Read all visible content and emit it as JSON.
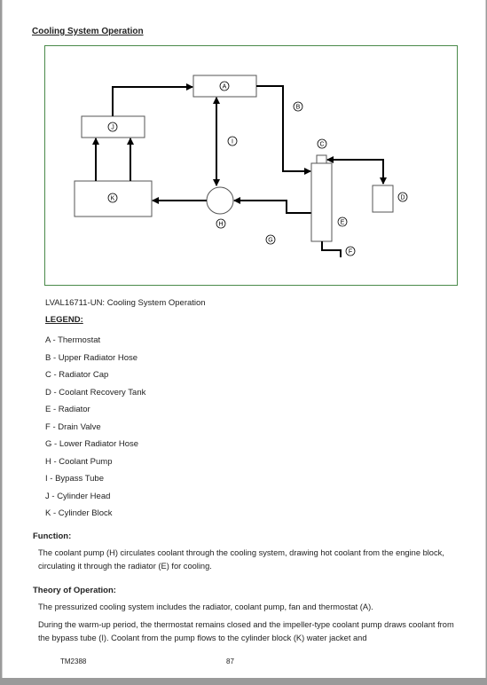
{
  "document": {
    "title": "Cooling System Operation",
    "figure": {
      "caption": "LVAL16711-UN: Cooling System Operation",
      "labels": {
        "A": "A",
        "B": "B",
        "C": "C",
        "D": "D",
        "E": "E",
        "F": "F",
        "G": "G",
        "H": "H",
        "I": "I",
        "J": "J",
        "K": "K"
      },
      "colors": {
        "border": "#4a8a4a",
        "lines": "#000000"
      }
    },
    "legend": {
      "title": "LEGEND:",
      "items": [
        "A - Thermostat",
        "B - Upper Radiator Hose",
        "C - Radiator Cap",
        "D - Coolant Recovery Tank",
        "E - Radiator",
        "F - Drain Valve",
        "G - Lower Radiator Hose",
        "H - Coolant Pump",
        "I - Bypass Tube",
        "J - Cylinder Head",
        "K - Cylinder Block"
      ]
    },
    "function": {
      "heading": "Function:",
      "text": "The coolant pump (H) circulates coolant through the cooling system, drawing hot coolant from the engine block, circulating it through the radiator (E) for cooling."
    },
    "theory": {
      "heading": "Theory of Operation:",
      "paragraphs": [
        "The pressurized cooling system includes the radiator, coolant pump, fan and thermostat (A).",
        "During the warm-up period, the thermostat remains closed and the impeller-type coolant pump draws coolant from the bypass tube (I). Coolant from the pump flows to the cylinder block (K) water jacket and"
      ]
    },
    "footer": {
      "doc_number": "TM2388",
      "page_number": "87"
    }
  }
}
